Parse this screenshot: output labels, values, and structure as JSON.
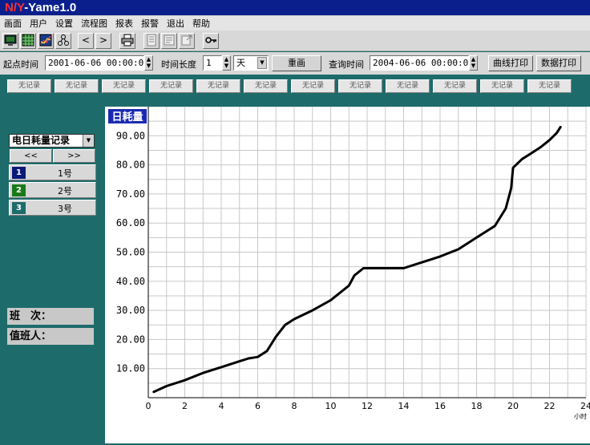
{
  "app": {
    "title_red": "N/Y",
    "title_white": "-Yame1.0"
  },
  "menu": [
    "画面",
    "用户",
    "设置",
    "流程图",
    "报表",
    "报警",
    "退出",
    "帮助"
  ],
  "toolbar": {
    "icons": [
      "monitor-icon",
      "grid-table-icon",
      "trend-chart-icon",
      "network-icon",
      "chevron-left-icon",
      "chevron-right-icon",
      "printer-icon",
      "report-icon",
      "document-icon",
      "export-icon",
      "key-icon"
    ],
    "left_glyph": "<",
    "right_glyph": ">"
  },
  "filter": {
    "start_label": "起点时间",
    "start_value": "2001-06-06  00:00:00",
    "duration_label": "时间长度",
    "duration_value": "1",
    "unit_value": "天",
    "redraw_label": "重画",
    "query_label": "查询时间",
    "query_value": "2004-06-06  00:00:00",
    "curve_print_label": "曲线打印",
    "data_print_label": "数据打印"
  },
  "records": [
    "无记录",
    "无记录",
    "无记录",
    "无记录",
    "无记录",
    "无记录",
    "无记录",
    "无记录",
    "无记录",
    "无记录",
    "无记录",
    "无记录"
  ],
  "sidebar": {
    "select_value": "电日耗量记录",
    "prev_label": "<<",
    "next_label": ">>",
    "series": [
      {
        "index": "1",
        "name": "1号",
        "color": "#0a1a78"
      },
      {
        "index": "2",
        "name": "2号",
        "color": "#1a7a1a"
      },
      {
        "index": "3",
        "name": "3号",
        "color": "#1e6b6b"
      }
    ],
    "shift_label": "班　次：",
    "duty_label": "值班人："
  },
  "chart_data": {
    "type": "line",
    "title": "日耗量",
    "xlabel": "小时",
    "ylabel": "",
    "xlim": [
      0,
      24
    ],
    "ylim": [
      0,
      100
    ],
    "xticks": [
      "0",
      "2",
      "4",
      "6",
      "8",
      "10",
      "12",
      "14",
      "16",
      "18",
      "20",
      "22",
      "24"
    ],
    "yticks": [
      "10.00",
      "20.00",
      "30.00",
      "40.00",
      "50.00",
      "60.00",
      "70.00",
      "80.00",
      "90.00"
    ],
    "grid": true,
    "line_color": "#000000",
    "series": [
      {
        "values": [
          [
            0.3,
            2
          ],
          [
            1,
            4
          ],
          [
            2,
            6
          ],
          [
            3,
            8.5
          ],
          [
            4,
            10.5
          ],
          [
            5,
            12.5
          ],
          [
            5.5,
            13.5
          ],
          [
            6,
            14
          ],
          [
            6.5,
            16
          ],
          [
            7,
            21
          ],
          [
            7.5,
            25
          ],
          [
            8,
            27
          ],
          [
            9,
            30
          ],
          [
            10,
            33.5
          ],
          [
            10.5,
            36
          ],
          [
            11,
            38.5
          ],
          [
            11.3,
            42
          ],
          [
            11.8,
            44.5
          ],
          [
            12,
            44.5
          ],
          [
            13,
            44.5
          ],
          [
            14,
            44.5
          ],
          [
            15,
            46.5
          ],
          [
            16,
            48.5
          ],
          [
            17,
            51
          ],
          [
            18,
            55
          ],
          [
            19,
            59
          ],
          [
            19.6,
            65
          ],
          [
            19.9,
            72
          ],
          [
            20,
            79
          ],
          [
            20.5,
            82
          ],
          [
            21,
            84
          ],
          [
            21.5,
            86
          ],
          [
            22,
            88.5
          ],
          [
            22.4,
            91
          ],
          [
            22.6,
            93
          ]
        ]
      }
    ]
  }
}
